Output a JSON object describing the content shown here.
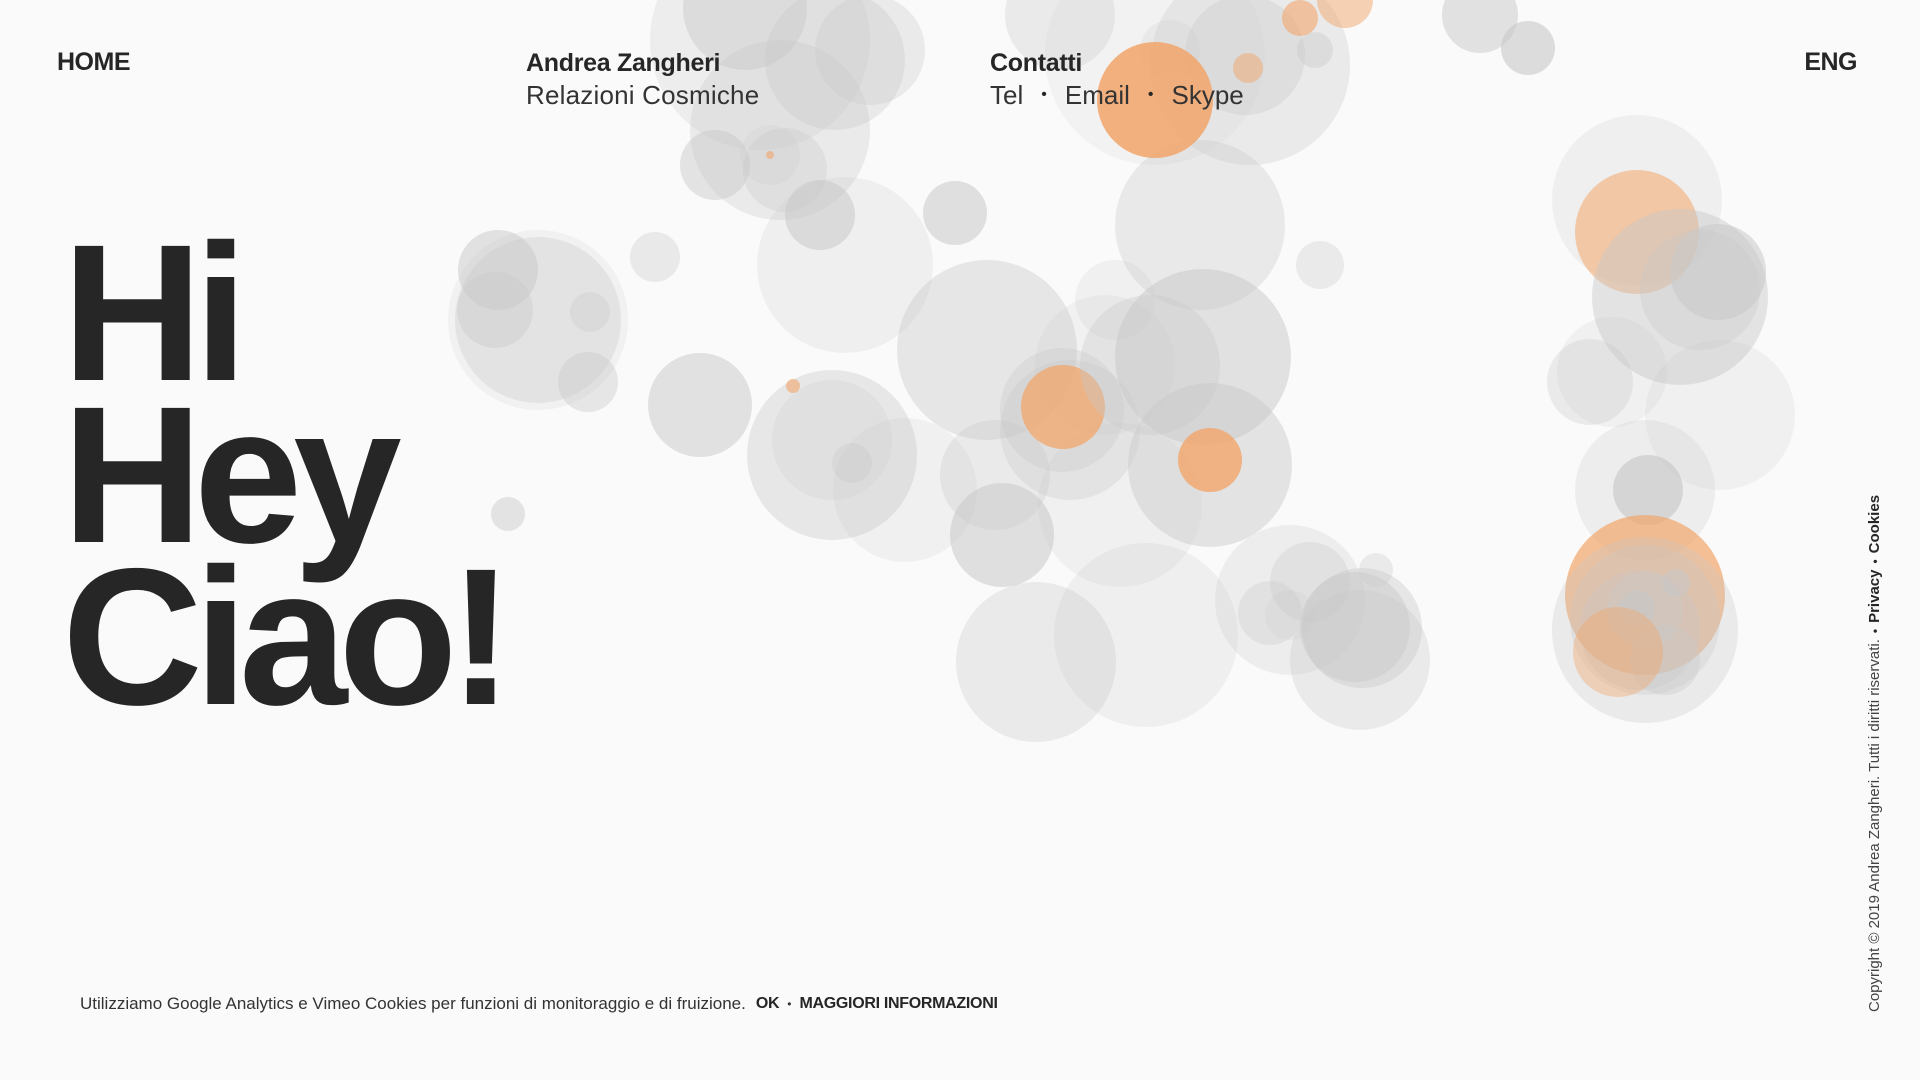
{
  "nav": {
    "home": "HOME",
    "lang": "ENG",
    "brand": {
      "name": "Andrea Zangheri",
      "tagline": "Relazioni Cosmiche"
    },
    "contact": {
      "title": "Contatti",
      "links": [
        "Tel",
        "Email",
        "Skype"
      ],
      "separator": "•"
    }
  },
  "hero": {
    "lines": [
      "Hi",
      "Hey",
      "Ciao!"
    ]
  },
  "cookie": {
    "text": "Utilizziamo Google Analytics e Vimeo Cookies per funzioni di monitoraggio e di fruizione.",
    "ok": "OK",
    "separator": "•",
    "more": "MAGGIORI INFORMAZIONI"
  },
  "footer": {
    "copyright": "Copyright © 2019 Andrea Zangheri. Tutti i diritti riservati.",
    "separator": "•",
    "privacy": "Privacy",
    "cookies": "Cookies"
  },
  "colors": {
    "background": "#fafafa",
    "text": "#262626",
    "bubble_grey": "#c8c8c8",
    "bubble_orange": "#f2a56a"
  }
}
